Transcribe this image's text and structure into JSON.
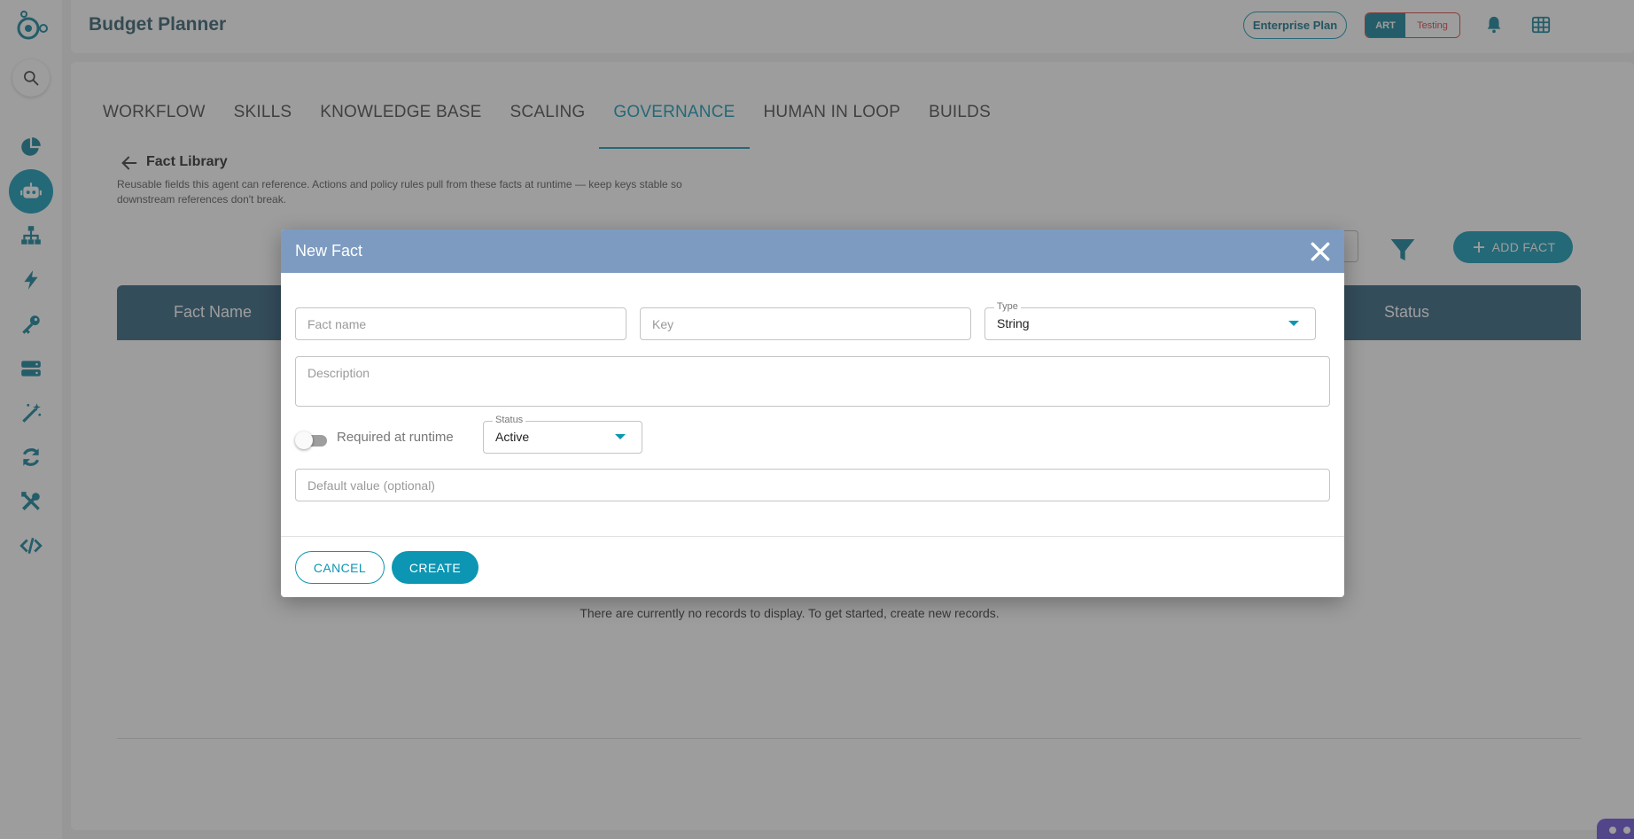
{
  "app": {
    "title": "Budget Planner"
  },
  "topbar": {
    "plan_label": "Enterprise Plan",
    "env_art": "ART",
    "env_testing": "Testing"
  },
  "tabs": [
    {
      "label": "WORKFLOW"
    },
    {
      "label": "SKILLS"
    },
    {
      "label": "KNOWLEDGE BASE"
    },
    {
      "label": "SCALING"
    },
    {
      "label": "GOVERNANCE",
      "active": true
    },
    {
      "label": "HUMAN IN LOOP"
    },
    {
      "label": "BUILDS"
    }
  ],
  "page": {
    "title": "Fact Library",
    "description": "Reusable fields this agent can reference. Actions and policy rules pull from these facts at runtime — keep keys stable so downstream references don't break.",
    "add_button": "ADD FACT",
    "table_headers": {
      "name": "Fact Name",
      "status": "Status"
    },
    "empty_message": "There are currently no records to display. To get started, create new records."
  },
  "modal": {
    "title": "New Fact",
    "fact_name_placeholder": "Fact name",
    "key_placeholder": "Key",
    "type_label": "Type",
    "type_value": "String",
    "description_placeholder": "Description",
    "required_label": "Required at runtime",
    "status_label": "Status",
    "status_value": "Active",
    "default_placeholder": "Default value (optional)",
    "cancel_label": "CANCEL",
    "create_label": "CREATE"
  },
  "colors": {
    "accent": "#0c96b3",
    "header_bar": "#7d9bc0",
    "table_header": "#2c5e7a",
    "avatar": "#d62a3e"
  },
  "icons": [
    "logo-icon",
    "search-icon",
    "pie-chart-icon",
    "robot-icon",
    "hierarchy-icon",
    "lightning-icon",
    "key-icon",
    "server-icon",
    "magic-wand-icon",
    "sync-icon",
    "tools-icon",
    "code-icon",
    "bell-icon",
    "grid-icon",
    "filter-icon",
    "plus-icon",
    "back-arrow-icon",
    "close-icon"
  ]
}
